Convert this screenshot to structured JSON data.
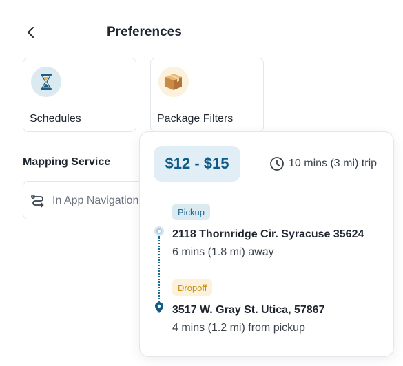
{
  "header": {
    "title": "Preferences",
    "back_icon": "chevron-left-icon"
  },
  "cards": [
    {
      "label": "Schedules",
      "icon": "hourglass-icon"
    },
    {
      "label": "Package Filters",
      "icon": "package-box-icon"
    }
  ],
  "mapping": {
    "label": "Mapping Service",
    "value": "In App Navigation",
    "icon": "route-icon"
  },
  "trip": {
    "price": "$12 - $15",
    "duration": "10 mins (3 mi) trip",
    "pickup": {
      "tag": "Pickup",
      "address": "2118 Thornridge Cir. Syracuse 35624",
      "eta": "6 mins (1.8 mi) away"
    },
    "dropoff": {
      "tag": "Dropoff",
      "address": "3517 W. Gray St. Utica,  57867",
      "eta": "4 mins (1.2 mi) from pickup"
    }
  },
  "colors": {
    "accent": "#0d5b86",
    "pickup_tag_bg": "#dbe9f1",
    "dropoff_tag_bg": "#fbf1dc",
    "dropoff_tag_text": "#c4930f"
  }
}
